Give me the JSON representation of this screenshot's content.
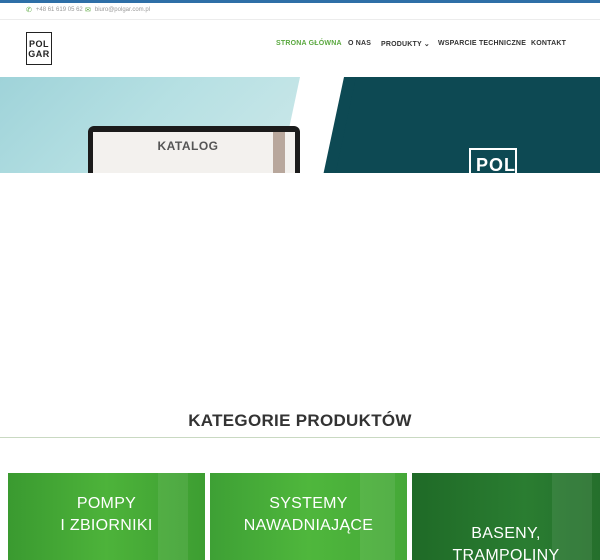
{
  "topbar": {
    "phone": "+48 61 619 05 62",
    "email": "biuro@polgar.com.pl",
    "phone_icon": "phone-icon",
    "email_icon": "email-icon"
  },
  "logo": {
    "line1": "POL",
    "line2": "GAR"
  },
  "nav": {
    "items": [
      {
        "label": "STRONA GŁÓWNA",
        "active": true
      },
      {
        "label": "O NAS"
      },
      {
        "label": "PRODUKTY ⌄"
      },
      {
        "label": "WSPARCIE TECHNICZNE"
      },
      {
        "label": "KONTAKT"
      }
    ]
  },
  "hero": {
    "screen_text": "KATALOG",
    "logo_text": "POL"
  },
  "categories": {
    "title": "KATEGORIE PRODUKTÓW",
    "cards": [
      {
        "line1": "POMPY",
        "line2": "I ZBIORNIKI"
      },
      {
        "line1": "SYSTEMY",
        "line2": "NAWADNIAJĄCE"
      },
      {
        "line1": "BASENY,",
        "line2": "TRAMPOLINY"
      }
    ]
  },
  "colors": {
    "accent_green": "#5aa83f",
    "hero_dark": "#0d4953",
    "top_strip": "#2e6fa7"
  }
}
